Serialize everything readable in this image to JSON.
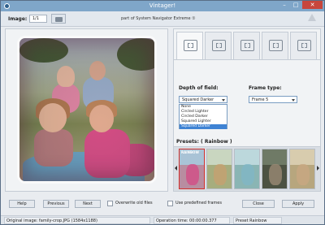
{
  "window": {
    "title": "Vintager!",
    "minimize_glyph": "–",
    "maximize_glyph": "□",
    "close_glyph": "✕"
  },
  "toolbar": {
    "image_label": "Image:",
    "image_index": "1/1",
    "subtitle": "part of System Navigator Extreme ①"
  },
  "tools": {
    "tabs": [
      {
        "icon": "frame-style-icon",
        "active": true
      },
      {
        "icon": "grid-crop-icon",
        "active": false
      },
      {
        "icon": "swap-images-icon",
        "active": false
      },
      {
        "icon": "layout-icon",
        "active": false
      },
      {
        "icon": "resize-icon",
        "active": false
      }
    ],
    "depth_label": "Depth of field:",
    "depth_value": "Squared Darker",
    "depth_options": [
      "None",
      "Circled Lighter",
      "Circled Darker",
      "Squared Lighter",
      "Squared Darker"
    ],
    "depth_selected_index": 4,
    "frame_label": "Frame type:",
    "frame_value": "Frame 5"
  },
  "presets": {
    "label": "Presets: ( Rainbow )",
    "selected_caption": "RAINBOW"
  },
  "buttons": {
    "help": "Help",
    "previous": "Previous",
    "next": "Next",
    "overwrite": "Overwrite old files",
    "use_predefined": "Use predefined frames",
    "close": "Close",
    "apply": "Apply"
  },
  "status": {
    "original_image": "Original image: family-crop.JPG (1584x1188)",
    "operation_time": "Operation time: 00:00:00.377",
    "preset": "Preset Rainbow"
  },
  "colors": {
    "titlebar": "#7fa6c9",
    "close_button": "#c7463c",
    "selection": "#3f83d4",
    "selected_thumb_border": "#d2322d"
  }
}
